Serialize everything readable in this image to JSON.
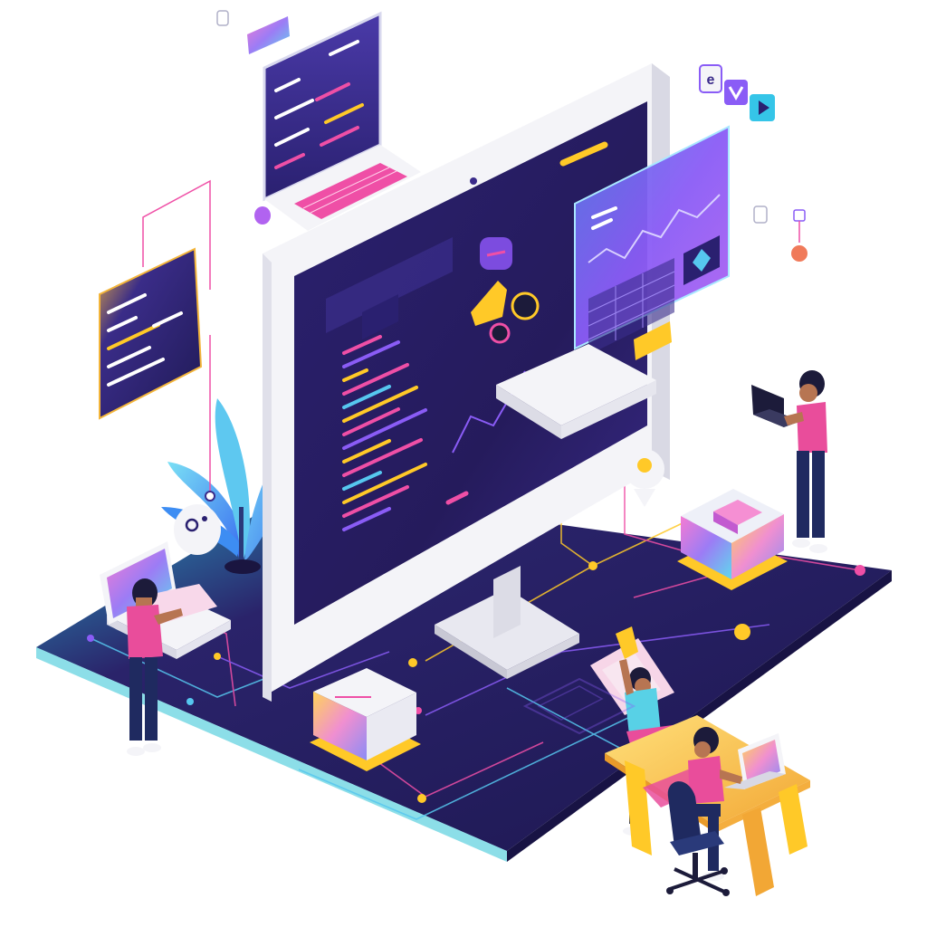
{
  "illustration": {
    "kind": "isometric web development scene",
    "colors": {
      "platform": "#241c5a",
      "platform_edge": "#2ec3d6",
      "screen_dark": "#231a56",
      "screen_mid": "#3a2a85",
      "monitor_frame": "#f4f4f8",
      "accent_purple": "#8a5cf6",
      "accent_pink": "#ef4fa6",
      "accent_yellow": "#ffc928",
      "accent_cyan": "#35c5e8",
      "skin": "#b77552",
      "hair": "#1c1b3a",
      "pants": "#1f2a60",
      "shirt_pink": "#e94d9b",
      "shirt_teal": "#58d1e6"
    },
    "icons": [
      "desktop-monitor-icon",
      "code-window-icon",
      "laptop-icon",
      "chart-panel-icon",
      "plant-icon",
      "cube-block-icon",
      "desk-icon",
      "chair-icon",
      "settings-icon",
      "play-icon",
      "location-pin-icon"
    ],
    "people_count": 4
  }
}
